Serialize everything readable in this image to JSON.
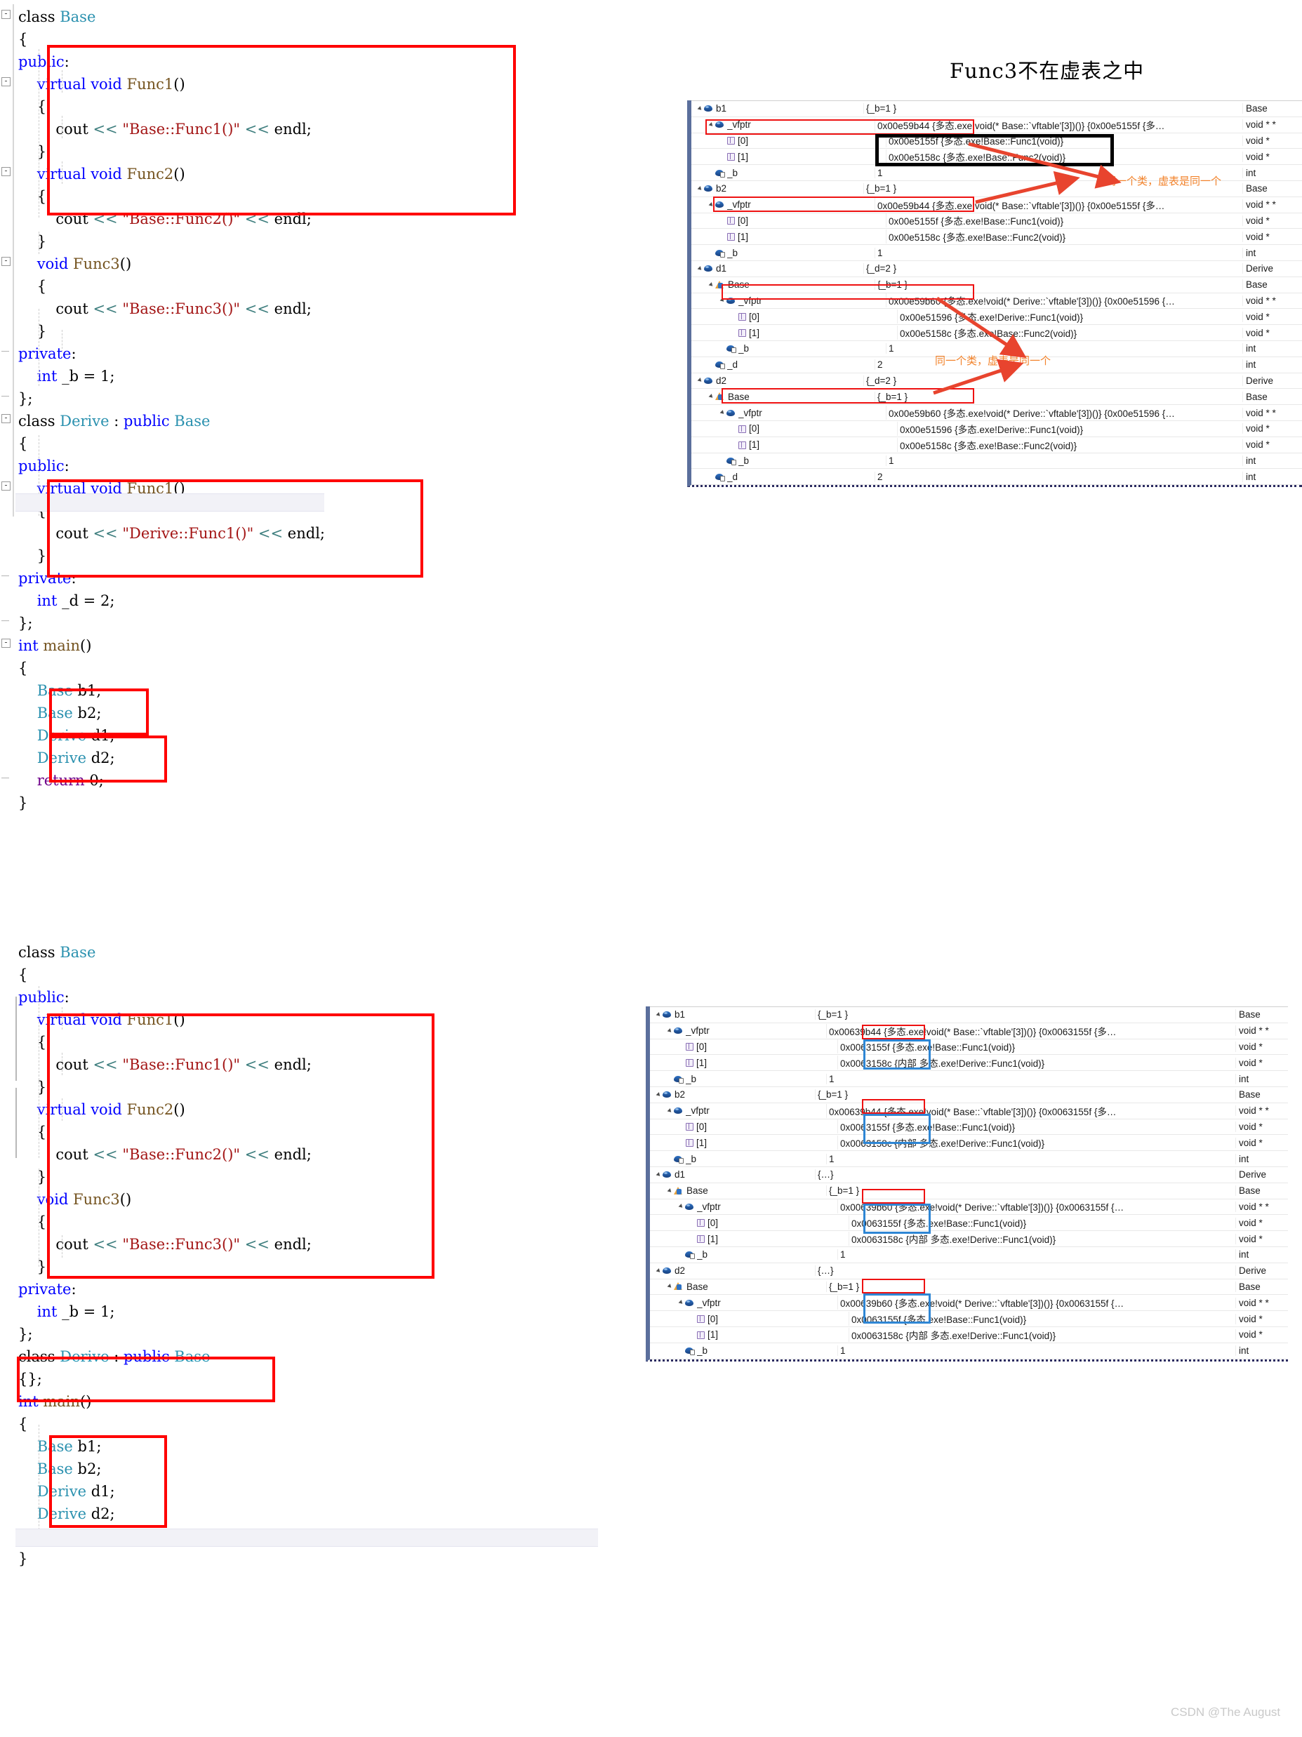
{
  "heading": "Func3不在虚表之中",
  "watermark": "CSDN @The  August",
  "annotations": {
    "same_class_1": "同一个类，虚表是同一个",
    "same_class_2": "同一个类，虚表是同一个"
  },
  "code_top": {
    "lines": [
      [
        [
          "plain",
          "class "
        ],
        [
          "type",
          "Base"
        ]
      ],
      [
        [
          "plain",
          "{"
        ]
      ],
      [
        [
          "kw",
          "public"
        ],
        [
          "plain",
          ":"
        ]
      ],
      [
        [
          "kw",
          "    virtual void "
        ],
        [
          "fn",
          "Func1"
        ],
        [
          "plain",
          "()"
        ]
      ],
      [
        [
          "plain",
          "    {"
        ]
      ],
      [
        [
          "plain",
          "        cout "
        ],
        [
          "op",
          "<< "
        ],
        [
          "str",
          "\"Base::Func1()\""
        ],
        [
          "op",
          " << "
        ],
        [
          "plain",
          "endl;"
        ]
      ],
      [
        [
          "plain",
          "    }"
        ]
      ],
      [
        [
          "kw",
          "    virtual void "
        ],
        [
          "fn",
          "Func2"
        ],
        [
          "plain",
          "()"
        ]
      ],
      [
        [
          "plain",
          "    {"
        ]
      ],
      [
        [
          "plain",
          "        cout "
        ],
        [
          "op",
          "<< "
        ],
        [
          "str",
          "\"Base::Func2()\""
        ],
        [
          "op",
          " << "
        ],
        [
          "plain",
          "endl;"
        ]
      ],
      [
        [
          "plain",
          "    }"
        ]
      ],
      [
        [
          "kw",
          "    void "
        ],
        [
          "fn",
          "Func3"
        ],
        [
          "plain",
          "()"
        ]
      ],
      [
        [
          "plain",
          "    {"
        ]
      ],
      [
        [
          "plain",
          "        cout "
        ],
        [
          "op",
          "<< "
        ],
        [
          "str",
          "\"Base::Func3()\""
        ],
        [
          "op",
          " << "
        ],
        [
          "plain",
          "endl;"
        ]
      ],
      [
        [
          "plain",
          "    }"
        ]
      ],
      [
        [
          "kw",
          "private"
        ],
        [
          "plain",
          ":"
        ]
      ],
      [
        [
          "kw",
          "    int "
        ],
        [
          "plain",
          "_b = 1;"
        ]
      ],
      [
        [
          "plain",
          "};"
        ]
      ],
      [
        [
          "plain",
          "class "
        ],
        [
          "type",
          "Derive"
        ],
        [
          "plain",
          " : "
        ],
        [
          "kw",
          "public "
        ],
        [
          "type",
          "Base"
        ]
      ],
      [
        [
          "plain",
          "{"
        ]
      ],
      [
        [
          "kw",
          "public"
        ],
        [
          "plain",
          ":"
        ]
      ],
      [
        [
          "kw",
          "    virtual void "
        ],
        [
          "fn",
          "Func1"
        ],
        [
          "plain",
          "()"
        ]
      ],
      [
        [
          "plain",
          "    {"
        ]
      ],
      [
        [
          "plain",
          "        cout "
        ],
        [
          "op",
          "<< "
        ],
        [
          "str",
          "\"Derive::Func1()\""
        ],
        [
          "op",
          " << "
        ],
        [
          "plain",
          "endl;"
        ]
      ],
      [
        [
          "plain",
          "    }"
        ]
      ],
      [
        [
          "kw",
          "private"
        ],
        [
          "plain",
          ":"
        ]
      ],
      [
        [
          "kw",
          "    int "
        ],
        [
          "plain",
          "_d = 2;"
        ]
      ],
      [
        [
          "plain",
          "};"
        ]
      ],
      [
        [
          "kw",
          "int "
        ],
        [
          "fn",
          "main"
        ],
        [
          "plain",
          "()"
        ]
      ],
      [
        [
          "plain",
          "{"
        ]
      ],
      [
        [
          "plain",
          "    "
        ],
        [
          "type",
          "Base"
        ],
        [
          "plain",
          " b1;"
        ]
      ],
      [
        [
          "plain",
          "    "
        ],
        [
          "type",
          "Base"
        ],
        [
          "plain",
          " b2;"
        ]
      ],
      [
        [
          "plain",
          "    "
        ],
        [
          "type",
          "Derive"
        ],
        [
          "plain",
          " d1;"
        ]
      ],
      [
        [
          "plain",
          "    "
        ],
        [
          "type",
          "Derive"
        ],
        [
          "plain",
          " d2;"
        ]
      ],
      [
        [
          "plain",
          "    "
        ],
        [
          "pp",
          "return"
        ],
        [
          "plain",
          " 0;"
        ]
      ],
      [
        [
          "plain",
          "}"
        ]
      ]
    ]
  },
  "code_bottom": {
    "lines": [
      [
        [
          "plain",
          "class "
        ],
        [
          "type",
          "Base"
        ]
      ],
      [
        [
          "plain",
          "{"
        ]
      ],
      [
        [
          "kw",
          "public"
        ],
        [
          "plain",
          ":"
        ]
      ],
      [
        [
          "kw",
          "    virtual void "
        ],
        [
          "fn",
          "Func1"
        ],
        [
          "plain",
          "()"
        ]
      ],
      [
        [
          "plain",
          "    {"
        ]
      ],
      [
        [
          "plain",
          "        cout "
        ],
        [
          "op",
          "<< "
        ],
        [
          "str",
          "\"Base::Func1()\""
        ],
        [
          "op",
          " << "
        ],
        [
          "plain",
          "endl;"
        ]
      ],
      [
        [
          "plain",
          "    }"
        ]
      ],
      [
        [
          "kw",
          "    virtual void "
        ],
        [
          "fn",
          "Func2"
        ],
        [
          "plain",
          "()"
        ]
      ],
      [
        [
          "plain",
          "    {"
        ]
      ],
      [
        [
          "plain",
          "        cout "
        ],
        [
          "op",
          "<< "
        ],
        [
          "str",
          "\"Base::Func2()\""
        ],
        [
          "op",
          " << "
        ],
        [
          "plain",
          "endl;"
        ]
      ],
      [
        [
          "plain",
          "    }"
        ]
      ],
      [
        [
          "kw",
          "    void "
        ],
        [
          "fn",
          "Func3"
        ],
        [
          "plain",
          "()"
        ]
      ],
      [
        [
          "plain",
          "    {"
        ]
      ],
      [
        [
          "plain",
          "        cout "
        ],
        [
          "op",
          "<< "
        ],
        [
          "str",
          "\"Base::Func3()\""
        ],
        [
          "op",
          " << "
        ],
        [
          "plain",
          "endl;"
        ]
      ],
      [
        [
          "plain",
          "    }"
        ]
      ],
      [
        [
          "kw",
          "private"
        ],
        [
          "plain",
          ":"
        ]
      ],
      [
        [
          "kw",
          "    int "
        ],
        [
          "plain",
          "_b = 1;"
        ]
      ],
      [
        [
          "plain",
          "};"
        ]
      ],
      [
        [
          "plain",
          "class "
        ],
        [
          "type",
          "Derive"
        ],
        [
          "plain",
          " : "
        ],
        [
          "kw",
          "public "
        ],
        [
          "type",
          "Base"
        ]
      ],
      [
        [
          "plain",
          "{};"
        ]
      ],
      [
        [
          "kw",
          "int "
        ],
        [
          "fn",
          "main"
        ],
        [
          "plain",
          "()"
        ]
      ],
      [
        [
          "plain",
          "{"
        ]
      ],
      [
        [
          "plain",
          "    "
        ],
        [
          "type",
          "Base"
        ],
        [
          "plain",
          " b1;"
        ]
      ],
      [
        [
          "plain",
          "    "
        ],
        [
          "type",
          "Base"
        ],
        [
          "plain",
          " b2;"
        ]
      ],
      [
        [
          "plain",
          "    "
        ],
        [
          "type",
          "Derive"
        ],
        [
          "plain",
          " d1;"
        ]
      ],
      [
        [
          "plain",
          "    "
        ],
        [
          "type",
          "Derive"
        ],
        [
          "plain",
          " d2;"
        ]
      ],
      [
        [
          "plain",
          "    "
        ],
        [
          "pp",
          "return"
        ],
        [
          "plain",
          " 0;"
        ]
      ],
      [
        [
          "plain",
          "}"
        ]
      ]
    ]
  },
  "watch_top": {
    "rows": [
      {
        "indent": 0,
        "expander": "down",
        "icon": "object",
        "name": "b1",
        "value": "{_b=1 }",
        "type": "Base"
      },
      {
        "indent": 1,
        "expander": "down",
        "icon": "object",
        "name": "_vfptr",
        "value": "0x00e59b44 {多态.exe!void(* Base::`vftable'[3])()} {0x00e5155f {多…",
        "type": "void * *"
      },
      {
        "indent": 2,
        "expander": "none",
        "icon": "cube",
        "name": "[0]",
        "value": "0x00e5155f {多态.exe!Base::Func1(void)}",
        "type": "void *"
      },
      {
        "indent": 2,
        "expander": "none",
        "icon": "cube",
        "name": "[1]",
        "value": "0x00e5158c {多态.exe!Base::Func2(void)}",
        "type": "void *"
      },
      {
        "indent": 1,
        "expander": "none",
        "icon": "object-locked",
        "name": "_b",
        "value": "1",
        "type": "int"
      },
      {
        "indent": 0,
        "expander": "down",
        "icon": "object",
        "name": "b2",
        "value": "{_b=1 }",
        "type": "Base"
      },
      {
        "indent": 1,
        "expander": "down",
        "icon": "object",
        "name": "_vfptr",
        "value": "0x00e59b44 {多态.exe!void(* Base::`vftable'[3])()} {0x00e5155f {多…",
        "type": "void * *"
      },
      {
        "indent": 2,
        "expander": "none",
        "icon": "cube",
        "name": "[0]",
        "value": "0x00e5155f {多态.exe!Base::Func1(void)}",
        "type": "void *"
      },
      {
        "indent": 2,
        "expander": "none",
        "icon": "cube",
        "name": "[1]",
        "value": "0x00e5158c {多态.exe!Base::Func2(void)}",
        "type": "void *"
      },
      {
        "indent": 1,
        "expander": "none",
        "icon": "object-locked",
        "name": "_b",
        "value": "1",
        "type": "int"
      },
      {
        "indent": 0,
        "expander": "down",
        "icon": "object",
        "name": "d1",
        "value": "{_d=2 }",
        "type": "Derive"
      },
      {
        "indent": 1,
        "expander": "down",
        "icon": "base",
        "name": "Base",
        "value": "{_b=1 }",
        "type": "Base"
      },
      {
        "indent": 2,
        "expander": "down",
        "icon": "object",
        "name": "_vfptr",
        "value": "0x00e59b60 {多态.exe!void(* Derive::`vftable'[3])()} {0x00e51596 {…",
        "type": "void * *"
      },
      {
        "indent": 3,
        "expander": "none",
        "icon": "cube",
        "name": "[0]",
        "value": "0x00e51596 {多态.exe!Derive::Func1(void)}",
        "type": "void *"
      },
      {
        "indent": 3,
        "expander": "none",
        "icon": "cube",
        "name": "[1]",
        "value": "0x00e5158c {多态.exe!Base::Func2(void)}",
        "type": "void *"
      },
      {
        "indent": 2,
        "expander": "none",
        "icon": "object-locked",
        "name": "_b",
        "value": "1",
        "type": "int"
      },
      {
        "indent": 1,
        "expander": "none",
        "icon": "object-locked",
        "name": "_d",
        "value": "2",
        "type": "int"
      },
      {
        "indent": 0,
        "expander": "down",
        "icon": "object",
        "name": "d2",
        "value": "{_d=2 }",
        "type": "Derive"
      },
      {
        "indent": 1,
        "expander": "down",
        "icon": "base",
        "name": "Base",
        "value": "{_b=1 }",
        "type": "Base"
      },
      {
        "indent": 2,
        "expander": "down",
        "icon": "object",
        "name": "_vfptr",
        "value": "0x00e59b60 {多态.exe!void(* Derive::`vftable'[3])()} {0x00e51596 {…",
        "type": "void * *"
      },
      {
        "indent": 3,
        "expander": "none",
        "icon": "cube",
        "name": "[0]",
        "value": "0x00e51596 {多态.exe!Derive::Func1(void)}",
        "type": "void *"
      },
      {
        "indent": 3,
        "expander": "none",
        "icon": "cube",
        "name": "[1]",
        "value": "0x00e5158c {多态.exe!Base::Func2(void)}",
        "type": "void *"
      },
      {
        "indent": 2,
        "expander": "none",
        "icon": "object-locked",
        "name": "_b",
        "value": "1",
        "type": "int"
      },
      {
        "indent": 1,
        "expander": "none",
        "icon": "object-locked",
        "name": "_d",
        "value": "2",
        "type": "int"
      }
    ]
  },
  "watch_bottom": {
    "rows": [
      {
        "indent": 0,
        "expander": "down",
        "icon": "object",
        "name": "b1",
        "value": "{_b=1 }",
        "type": "Base"
      },
      {
        "indent": 1,
        "expander": "down",
        "icon": "object",
        "name": "_vfptr",
        "value": "0x00639b44 {多态.exe!void(* Base::`vftable'[3])()} {0x0063155f {多…",
        "type": "void * *"
      },
      {
        "indent": 2,
        "expander": "none",
        "icon": "cube",
        "name": "[0]",
        "value": "0x0063155f {多态.exe!Base::Func1(void)}",
        "type": "void *"
      },
      {
        "indent": 2,
        "expander": "none",
        "icon": "cube",
        "name": "[1]",
        "value": "0x0063158c {内部 多态.exe!Derive::Func1(void)}",
        "type": "void *"
      },
      {
        "indent": 1,
        "expander": "none",
        "icon": "object-locked",
        "name": "_b",
        "value": "1",
        "type": "int"
      },
      {
        "indent": 0,
        "expander": "down",
        "icon": "object",
        "name": "b2",
        "value": "{_b=1 }",
        "type": "Base"
      },
      {
        "indent": 1,
        "expander": "down",
        "icon": "object",
        "name": "_vfptr",
        "value": "0x00639b44 {多态.exe!void(* Base::`vftable'[3])()} {0x0063155f {多…",
        "type": "void * *"
      },
      {
        "indent": 2,
        "expander": "none",
        "icon": "cube",
        "name": "[0]",
        "value": "0x0063155f {多态.exe!Base::Func1(void)}",
        "type": "void *"
      },
      {
        "indent": 2,
        "expander": "none",
        "icon": "cube",
        "name": "[1]",
        "value": "0x0063158c {内部 多态.exe!Derive::Func1(void)}",
        "type": "void *"
      },
      {
        "indent": 1,
        "expander": "none",
        "icon": "object-locked",
        "name": "_b",
        "value": "1",
        "type": "int"
      },
      {
        "indent": 0,
        "expander": "down",
        "icon": "object",
        "name": "d1",
        "value": "{…}",
        "type": "Derive"
      },
      {
        "indent": 1,
        "expander": "down",
        "icon": "base",
        "name": "Base",
        "value": "{_b=1 }",
        "type": "Base"
      },
      {
        "indent": 2,
        "expander": "down",
        "icon": "object",
        "name": "_vfptr",
        "value": "0x00639b60 {多态.exe!void(* Derive::`vftable'[3])()} {0x0063155f {…",
        "type": "void * *"
      },
      {
        "indent": 3,
        "expander": "none",
        "icon": "cube",
        "name": "[0]",
        "value": "0x0063155f {多态.exe!Base::Func1(void)}",
        "type": "void *"
      },
      {
        "indent": 3,
        "expander": "none",
        "icon": "cube",
        "name": "[1]",
        "value": "0x0063158c {内部 多态.exe!Derive::Func1(void)}",
        "type": "void *"
      },
      {
        "indent": 2,
        "expander": "none",
        "icon": "object-locked",
        "name": "_b",
        "value": "1",
        "type": "int"
      },
      {
        "indent": 0,
        "expander": "down",
        "icon": "object",
        "name": "d2",
        "value": "{…}",
        "type": "Derive"
      },
      {
        "indent": 1,
        "expander": "down",
        "icon": "base",
        "name": "Base",
        "value": "{_b=1 }",
        "type": "Base"
      },
      {
        "indent": 2,
        "expander": "down",
        "icon": "object",
        "name": "_vfptr",
        "value": "0x00639b60 {多态.exe!void(* Derive::`vftable'[3])()} {0x0063155f {…",
        "type": "void * *"
      },
      {
        "indent": 3,
        "expander": "none",
        "icon": "cube",
        "name": "[0]",
        "value": "0x0063155f {多态.exe!Base::Func1(void)}",
        "type": "void *"
      },
      {
        "indent": 3,
        "expander": "none",
        "icon": "cube",
        "name": "[1]",
        "value": "0x0063158c {内部 多态.exe!Derive::Func1(void)}",
        "type": "void *"
      },
      {
        "indent": 2,
        "expander": "none",
        "icon": "object-locked",
        "name": "_b",
        "value": "1",
        "type": "int"
      }
    ]
  }
}
